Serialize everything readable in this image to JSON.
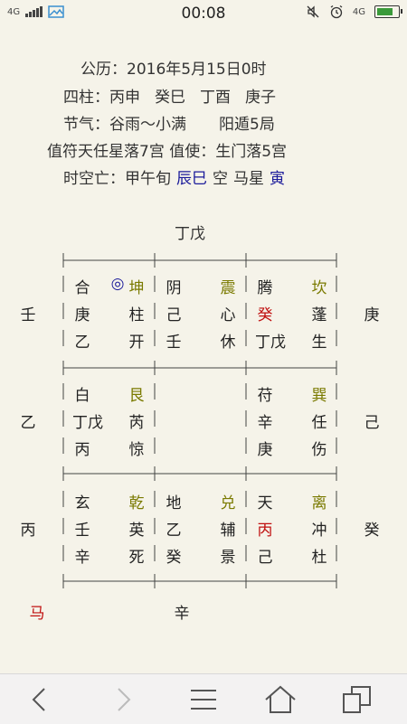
{
  "status": {
    "network": "4G",
    "time": "00:08",
    "network2": "4G"
  },
  "info": {
    "calendar": "公历：2016年5月15日0时",
    "pillars_label": "四柱：",
    "pillars": [
      "丙申",
      "癸巳",
      "丁酉",
      "庚子"
    ],
    "jieqi": "节气：谷雨～小满",
    "ju": "阳遁5局",
    "zhifu": "值符天任星落7宫 值使：生门落5宫",
    "kongwang_label": "时空亡：甲午旬",
    "kongwang_value": "辰巳",
    "kong": "空",
    "maxing_label": "马星",
    "maxing_value": "寅"
  },
  "top_label": "丁戊",
  "bottom_label": "辛",
  "horse_mark": "马",
  "side_labels": {
    "left": [
      "壬",
      "乙",
      "丙"
    ],
    "right": [
      "庚",
      "己",
      "癸"
    ]
  },
  "palaces": [
    {
      "id": "kun",
      "rows": [
        [
          "合",
          "坤"
        ],
        [
          "庚",
          "柱"
        ],
        [
          "乙",
          "开"
        ]
      ],
      "circle": "◎"
    },
    {
      "id": "zhen",
      "rows": [
        [
          "阴",
          "震"
        ],
        [
          "己",
          "心"
        ],
        [
          "壬",
          "休"
        ]
      ]
    },
    {
      "id": "kan",
      "rows": [
        [
          "腾",
          "坎"
        ],
        [
          "癸",
          "蓬"
        ],
        [
          "丁戊",
          "生"
        ]
      ]
    },
    {
      "id": "gen",
      "rows": [
        [
          "白",
          "艮"
        ],
        [
          "丁戊",
          "芮"
        ],
        [
          "丙",
          "惊"
        ]
      ]
    },
    {
      "id": "center",
      "rows": []
    },
    {
      "id": "xun",
      "rows": [
        [
          "苻",
          "巽"
        ],
        [
          "辛",
          "任"
        ],
        [
          "庚",
          "伤"
        ]
      ]
    },
    {
      "id": "qian",
      "rows": [
        [
          "玄",
          "乾"
        ],
        [
          "壬",
          "英"
        ],
        [
          "辛",
          "死"
        ]
      ]
    },
    {
      "id": "dui",
      "rows": [
        [
          "地",
          "兑"
        ],
        [
          "乙",
          "辅"
        ],
        [
          "癸",
          "景"
        ]
      ]
    },
    {
      "id": "li",
      "rows": [
        [
          "天",
          "离"
        ],
        [
          "丙",
          "冲"
        ],
        [
          "己",
          "杜"
        ]
      ]
    }
  ],
  "colors": {
    "trigram": "#7a7a00",
    "red": "#c01010",
    "blue": "#1a1a9a",
    "background": "#f5f3e9"
  }
}
